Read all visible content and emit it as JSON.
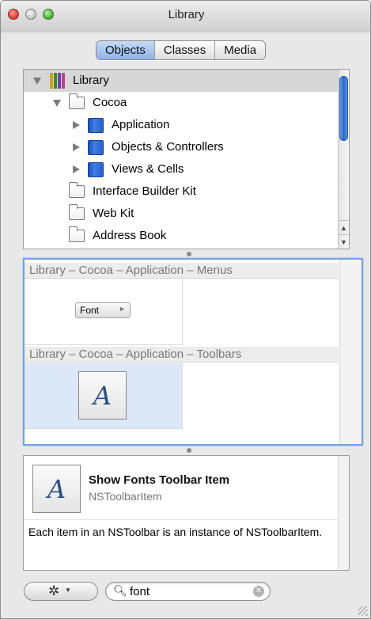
{
  "window": {
    "title": "Library"
  },
  "tabs": [
    {
      "label": "Objects",
      "active": true
    },
    {
      "label": "Classes",
      "active": false
    },
    {
      "label": "Media",
      "active": false
    }
  ],
  "outline": {
    "items": [
      {
        "label": "Library",
        "icon": "library-books-icon",
        "disclosure": "expanded",
        "level": 0
      },
      {
        "label": "Cocoa",
        "icon": "folder-icon",
        "disclosure": "expanded",
        "level": 1
      },
      {
        "label": "Application",
        "icon": "blue-book-icon",
        "disclosure": "collapsed",
        "level": 2
      },
      {
        "label": "Objects & Controllers",
        "icon": "blue-book-icon",
        "disclosure": "collapsed",
        "level": 2
      },
      {
        "label": "Views & Cells",
        "icon": "blue-book-icon",
        "disclosure": "collapsed",
        "level": 2
      },
      {
        "label": "Interface Builder Kit",
        "icon": "folder-icon",
        "disclosure": "none",
        "level": 1
      },
      {
        "label": "Web Kit",
        "icon": "folder-icon",
        "disclosure": "none",
        "level": 1
      },
      {
        "label": "Address Book",
        "icon": "folder-icon",
        "disclosure": "none",
        "level": 1
      }
    ]
  },
  "gallery": {
    "sections": [
      {
        "title": "Library – Cocoa – Application – Menus",
        "item_label": "Font",
        "item_arrow": "►"
      },
      {
        "title": "Library – Cocoa – Application – Toolbars",
        "item_glyph": "A"
      }
    ]
  },
  "details": {
    "icon_glyph": "A",
    "title": "Show Fonts Toolbar Item",
    "class_name": "NSToolbarItem",
    "description": "Each item in an NSToolbar is an instance of NSToolbarItem."
  },
  "bottom": {
    "action_glyph": "✲",
    "action_caret": "▼",
    "search_value": "font",
    "search_icon": "magnifier-icon",
    "clear_glyph": "✕"
  },
  "colors": {
    "selection_blue": "#75a1e0",
    "scroll_thumb": "#2b68cd"
  }
}
